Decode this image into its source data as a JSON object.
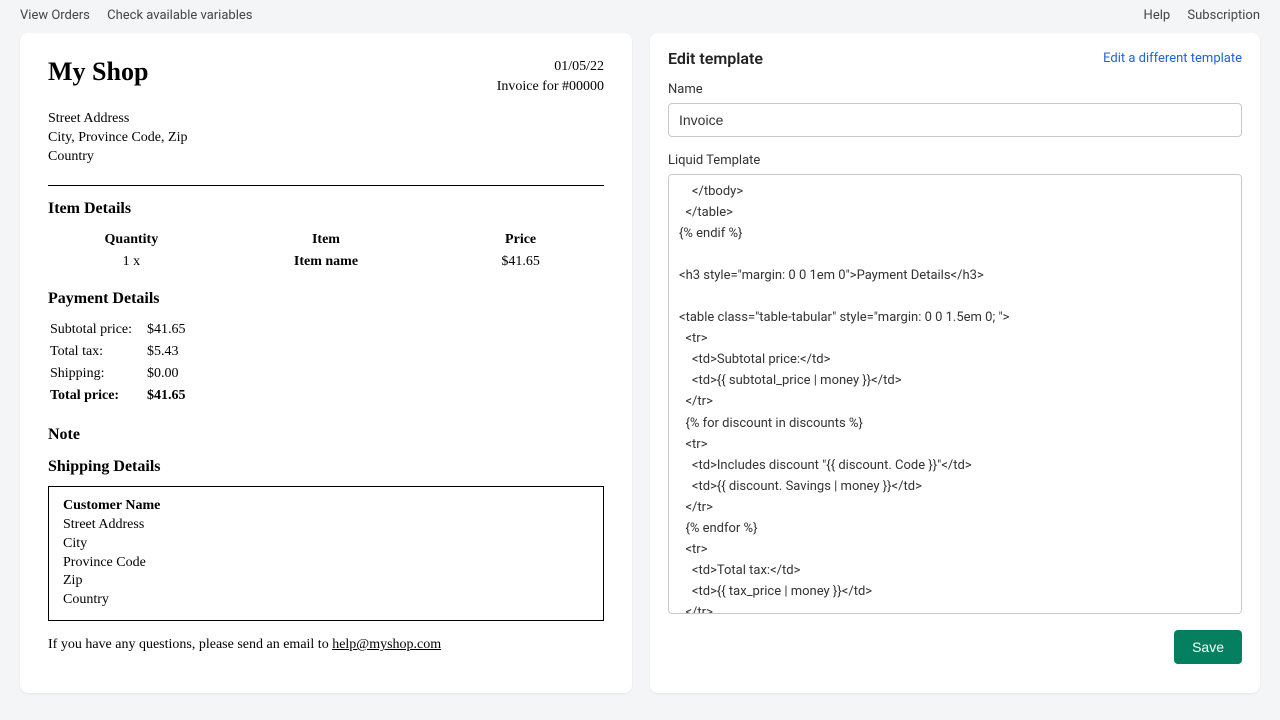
{
  "topbar": {
    "view_orders": "View Orders",
    "check_vars": "Check available variables",
    "help": "Help",
    "subscription": "Subscription"
  },
  "preview": {
    "shop_name": "My Shop",
    "date": "01/05/22",
    "invoice_for": "Invoice for #00000",
    "address": {
      "street": "Street Address",
      "csz": "City, Province Code, Zip",
      "country": "Country"
    },
    "section_items": "Item Details",
    "items_headers": {
      "qty": "Quantity",
      "item": "Item",
      "price": "Price"
    },
    "items": [
      {
        "qty": "1 x",
        "name": "Item name",
        "price": "$41.65"
      }
    ],
    "section_payment": "Payment Details",
    "payment": {
      "subtotal_label": "Subtotal price:",
      "subtotal_value": "$41.65",
      "tax_label": "Total tax:",
      "tax_value": "$5.43",
      "shipping_label": "Shipping:",
      "shipping_value": "$0.00",
      "total_label": "Total price:",
      "total_value": "$41.65"
    },
    "section_note": "Note",
    "section_shipping": "Shipping Details",
    "shipping": {
      "name": "Customer Name",
      "street": "Street Address",
      "city": "City",
      "province": "Province Code",
      "zip": "Zip",
      "country": "Country"
    },
    "footer_prefix": "If you have any questions, please send an email to ",
    "footer_email": "help@myshop.com"
  },
  "editor": {
    "title": "Edit template",
    "edit_other": "Edit a different template",
    "name_label": "Name",
    "name_value": "Invoice",
    "liquid_label": "Liquid Template",
    "liquid_code": "    </tbody>\n  </table>\n{% endif %}\n\n<h3 style=\"margin: 0 0 1em 0\">Payment Details</h3>\n\n<table class=\"table-tabular\" style=\"margin: 0 0 1.5em 0; \">\n  <tr>\n    <td>Subtotal price:</td>\n    <td>{{ subtotal_price | money }}</td>\n  </tr>\n  {% for discount in discounts %}\n  <tr>\n    <td>Includes discount \"{{ discount. Code }}\"</td>\n    <td>{{ discount. Savings | money }}</td>\n  </tr>\n  {% endfor %}\n  <tr>\n    <td>Total tax:</td>\n    <td>{{ tax_price | money }}</td>\n  </tr>\n  <tr>",
    "save": "Save"
  }
}
